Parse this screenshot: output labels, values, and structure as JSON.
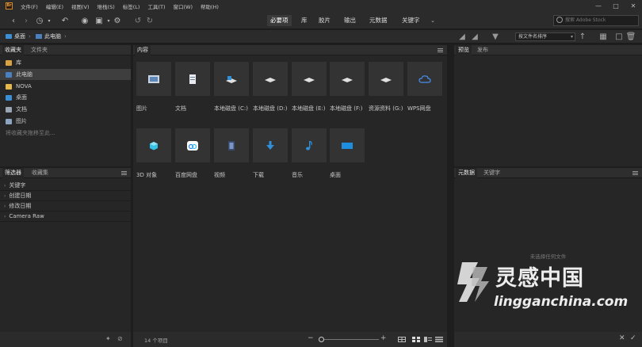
{
  "menu": {
    "items": [
      "文件(F)",
      "编辑(E)",
      "视图(V)",
      "堆栈(S)",
      "标签(L)",
      "工具(T)",
      "窗口(W)",
      "帮助(H)"
    ],
    "app_logo_text": "Br"
  },
  "toolbar": {
    "workspaces": [
      "必要项",
      "库",
      "胶片",
      "输出",
      "元数据",
      "关键字"
    ],
    "active_workspace": "必要项",
    "search_placeholder": "搜索 Adobe Stock"
  },
  "path": {
    "crumbs": [
      "桌面",
      "此电脑"
    ],
    "sort_label": "按文件名排序"
  },
  "left_top_panel": {
    "tabs": [
      "收藏夹",
      "文件夹"
    ],
    "items": [
      {
        "label": "库",
        "icon": "library-icon",
        "color": "#d9a341"
      },
      {
        "label": "此电脑",
        "icon": "computer-icon",
        "color": "#4a7fc0"
      },
      {
        "label": "NOVA",
        "icon": "folder-icon",
        "color": "#e6b84a"
      },
      {
        "label": "桌面",
        "icon": "desktop-icon",
        "color": "#3b8fd6"
      },
      {
        "label": "文档",
        "icon": "document-icon",
        "color": "#9aa6b3"
      },
      {
        "label": "图片",
        "icon": "picture-icon",
        "color": "#8ba4c0"
      }
    ],
    "hint": "将收藏夹拖移至此..."
  },
  "left_bottom_panel": {
    "tabs": [
      "筛选器",
      "收藏集"
    ],
    "filters": [
      "关键字",
      "创建日期",
      "修改日期",
      "Camera Raw"
    ]
  },
  "content_panel": {
    "tab": "内容",
    "items": [
      {
        "label": "图片",
        "icon": "picture-icon"
      },
      {
        "label": "文档",
        "icon": "document-icon"
      },
      {
        "label": "本地磁盘 (C:)",
        "icon": "system-drive-icon"
      },
      {
        "label": "本地磁盘 (D:)",
        "icon": "drive-icon"
      },
      {
        "label": "本地磁盘 (E:)",
        "icon": "drive-icon"
      },
      {
        "label": "本地磁盘 (F:)",
        "icon": "drive-icon"
      },
      {
        "label": "资源资料 (G:)",
        "icon": "drive-icon"
      },
      {
        "label": "WPS网盘",
        "icon": "cloud-icon"
      },
      {
        "label": "3D 对象",
        "icon": "3d-object-icon"
      },
      {
        "label": "百度网盘",
        "icon": "baidu-netdisk-icon"
      },
      {
        "label": "视频",
        "icon": "video-icon"
      },
      {
        "label": "下载",
        "icon": "download-icon"
      },
      {
        "label": "音乐",
        "icon": "music-icon"
      },
      {
        "label": "桌面",
        "icon": "desktop-icon"
      }
    ],
    "status": "14 个项目"
  },
  "right_top_panel": {
    "tabs": [
      "预览",
      "发布"
    ]
  },
  "right_bottom_panel": {
    "tabs": [
      "元数据",
      "关键字"
    ],
    "empty_text": "未选择任何文件"
  },
  "watermark": {
    "brand": "灵感中国",
    "url": "lingganchina.com"
  }
}
